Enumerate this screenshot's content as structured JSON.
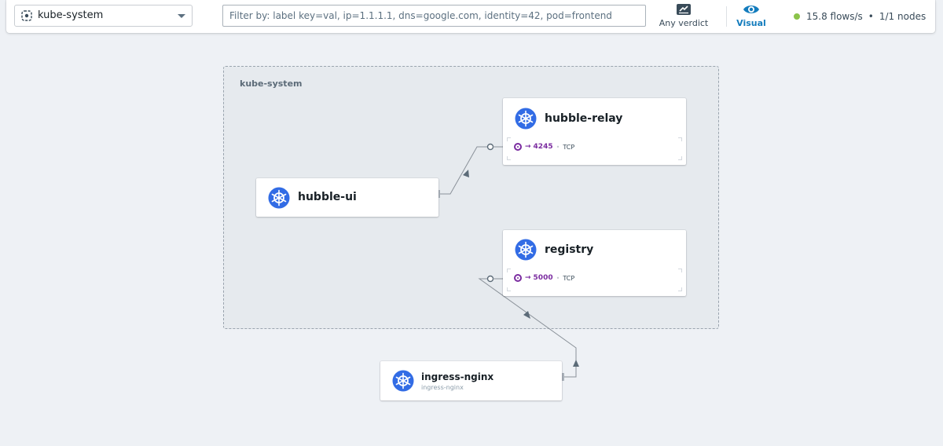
{
  "topbar": {
    "namespace": {
      "value": "kube-system",
      "icon": "namespace-icon",
      "expand_icon": "chevron-down-icon"
    },
    "filter": {
      "value": "",
      "placeholder": "Filter by: label key=val, ip=1.1.1.1, dns=google.com, identity=42, pod=frontend"
    },
    "verdict_button": {
      "label": "Any verdict",
      "icon": "verdict-icon"
    },
    "visual_button": {
      "label": "Visual",
      "icon": "eye-icon",
      "active": true
    },
    "status": {
      "flows": "15.8 flows/s",
      "separator": "•",
      "nodes": "1/1 nodes",
      "dot_color": "#8bc34a"
    }
  },
  "map": {
    "namespace_box": {
      "title": "kube-system"
    },
    "services": [
      {
        "id": "hubble-relay",
        "title": "hubble-relay",
        "icon": "kubernetes-icon",
        "ports": [
          {
            "arrow": "→",
            "port": "4245",
            "protocol": "TCP"
          }
        ]
      },
      {
        "id": "hubble-ui",
        "title": "hubble-ui",
        "icon": "kubernetes-icon",
        "ports": []
      },
      {
        "id": "registry",
        "title": "registry",
        "icon": "kubernetes-icon",
        "ports": [
          {
            "arrow": "→",
            "port": "5000",
            "protocol": "TCP"
          }
        ]
      },
      {
        "id": "ingress-nginx",
        "title": "ingress-nginx",
        "subtitle": "ingress-nginx",
        "icon": "kubernetes-icon",
        "ports": []
      }
    ],
    "edges": [
      {
        "from": "hubble-ui",
        "to": "hubble-relay",
        "port": "4245"
      },
      {
        "from": "ingress-nginx",
        "to": "registry",
        "port": "5000"
      }
    ],
    "colors": {
      "kubernetes_blue": "#326ce5",
      "port_purple": "#7b2ca0",
      "edge": "#8a9199",
      "accent": "#137cbd"
    }
  }
}
